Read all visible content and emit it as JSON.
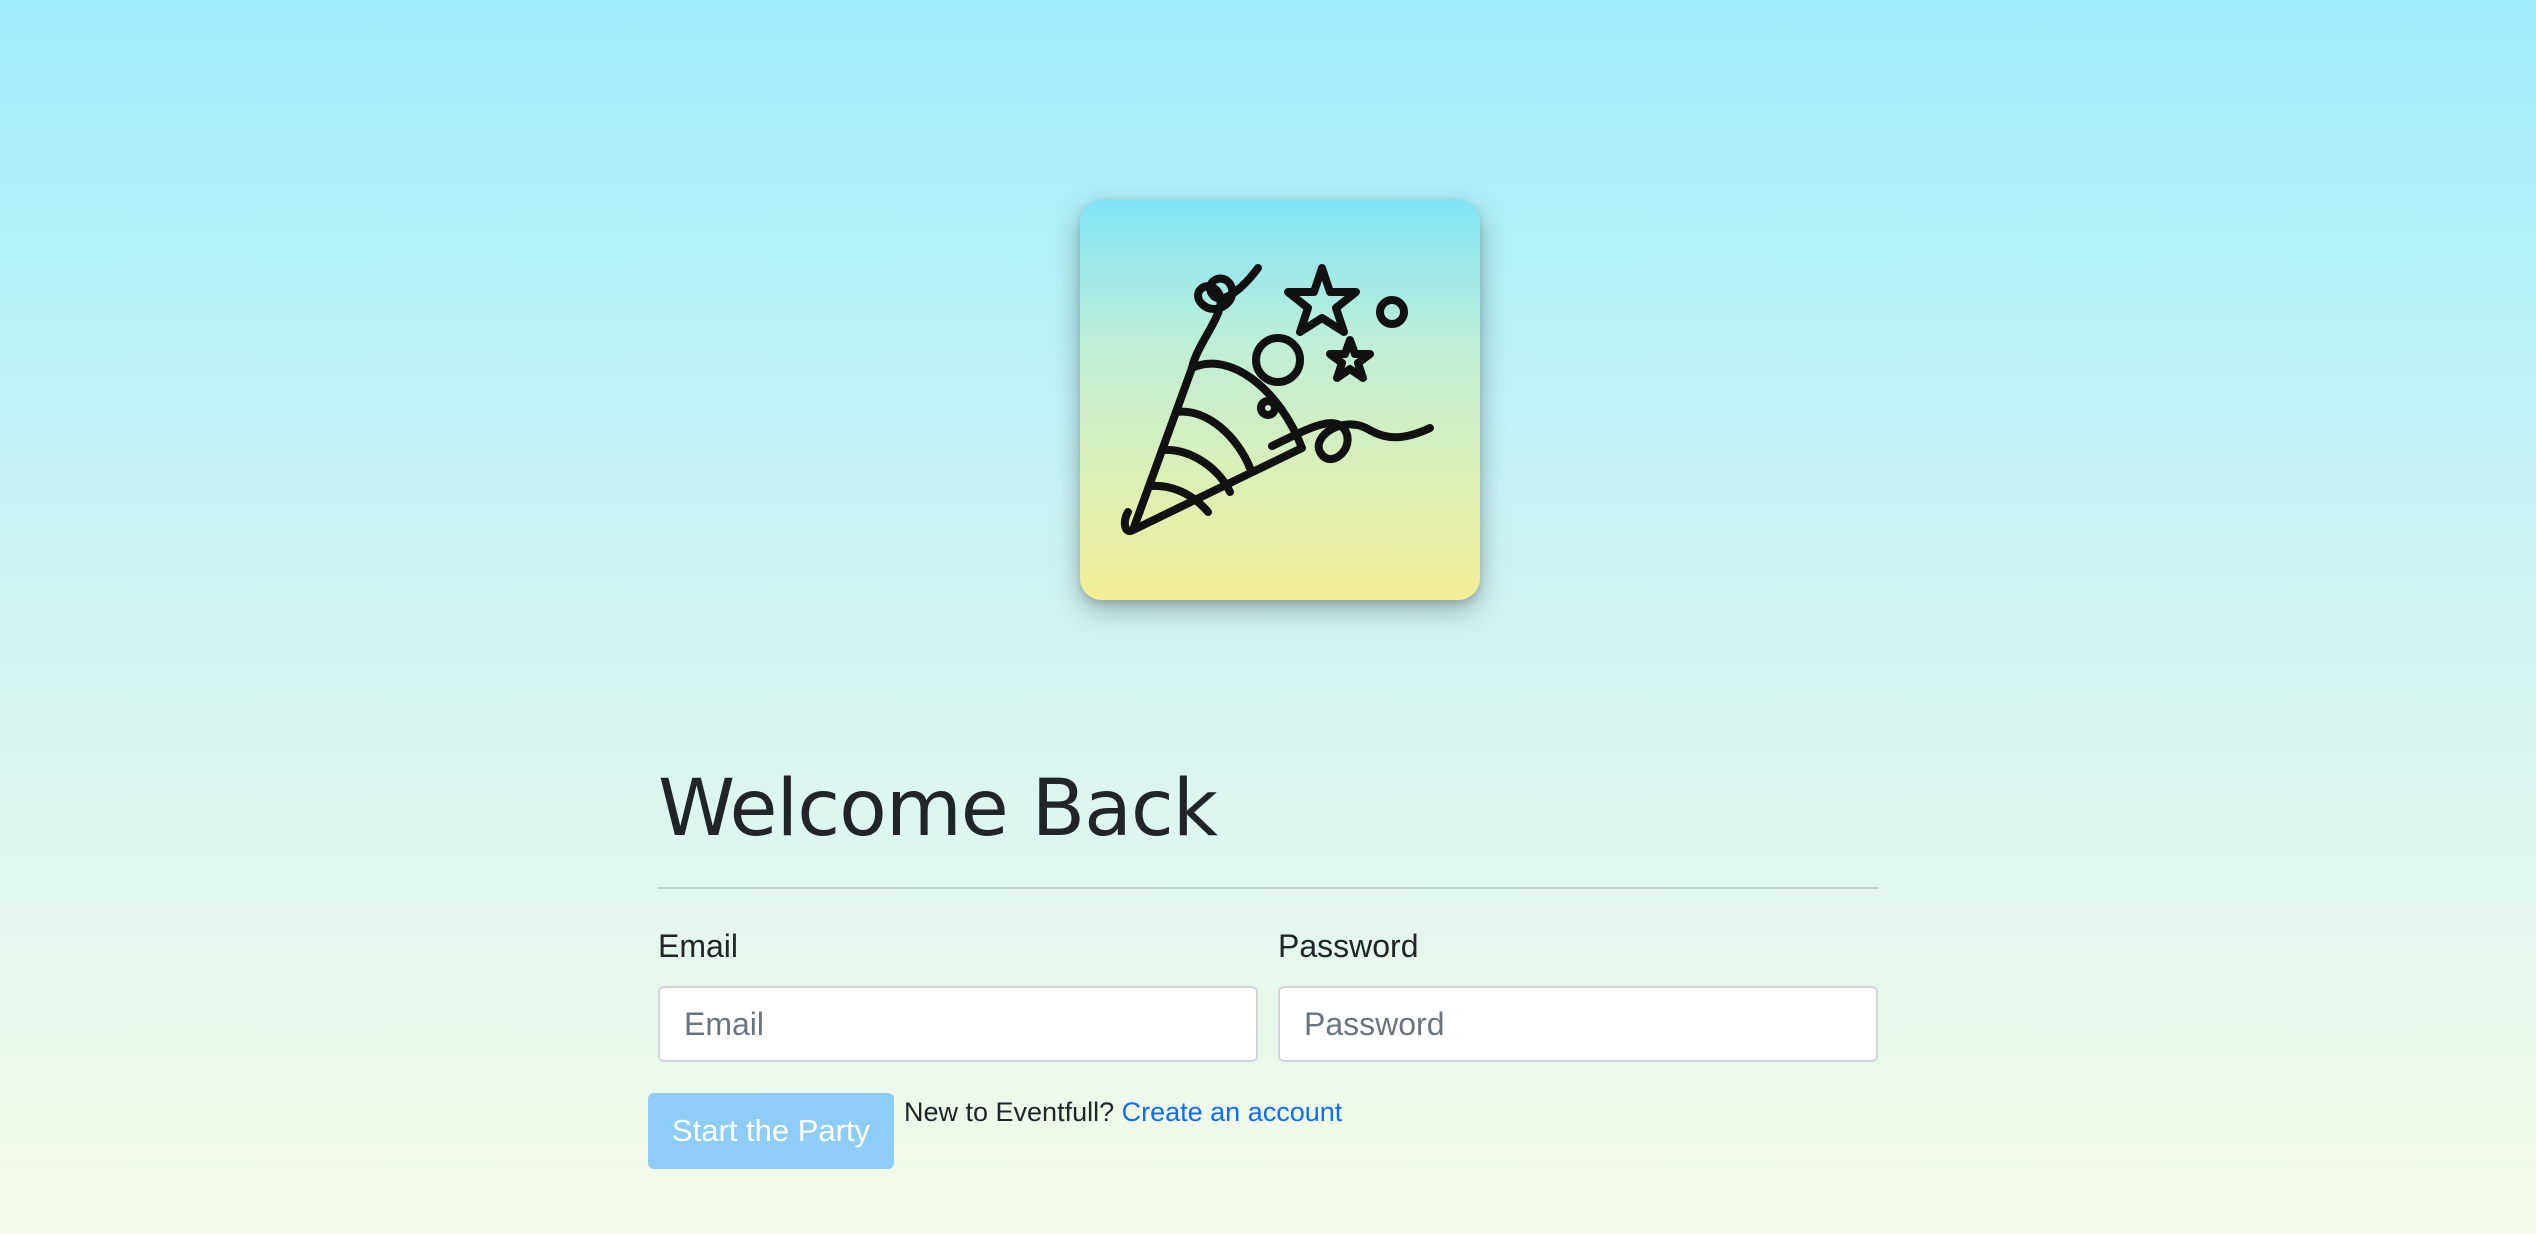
{
  "logo": {
    "icon": "party-popper-icon",
    "gradient_top": "#80e4f6",
    "gradient_bottom": "#f3ef96"
  },
  "login": {
    "title": "Welcome Back",
    "email_label": "Email",
    "email_placeholder": "Email",
    "email_value": "",
    "password_label": "Password",
    "password_placeholder": "Password",
    "password_value": "",
    "submit_label": "Start the Party",
    "signup_prompt": "New to Eventfull?",
    "signup_link": "Create an account"
  },
  "colors": {
    "primary_button": "#8ecdf7",
    "link": "#0d6efd",
    "background_top": "#9fecfd",
    "background_bottom": "#f4fae8"
  }
}
